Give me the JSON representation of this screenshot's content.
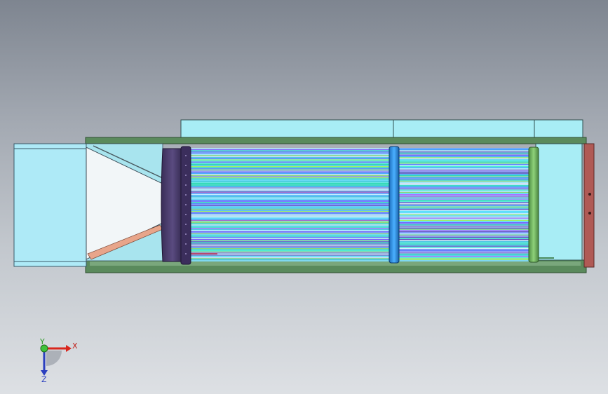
{
  "model": {
    "colors": {
      "background_top": "#7e8590",
      "background_bottom": "#dde0e4",
      "frame_green": "#5a8a5c",
      "frame_green_dark": "#2f4f31",
      "cyan_panel": "#a8edf5",
      "inlet_cyan": "#aeeaf7",
      "funnel_white": "#f2f6f8",
      "rod_orange": "#e8a58a",
      "endcap_purple": "#4b3c6e",
      "ring_blue": "#2a8ad9",
      "ring_green": "#6fb35a",
      "end_plate_red": "#b05a55"
    },
    "fiber_palette": [
      "#58e0ff",
      "#7b5cff",
      "#9ef06a",
      "#3fa0ff",
      "#c7f2ff",
      "#b16bff",
      "#2ddbb0",
      "#e0e0f0",
      "#5f7bff",
      "#8cd67a",
      "#40c0e0",
      "#a070d0",
      "#d8f0ff",
      "#6a50c0",
      "#4ef0d0"
    ]
  },
  "triad": {
    "x_label": "X",
    "y_label": "Y",
    "z_label": "Z"
  }
}
